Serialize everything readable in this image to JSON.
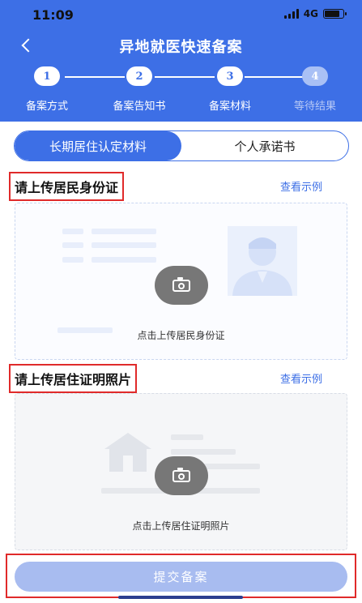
{
  "status": {
    "time": "11:09",
    "network": "4G"
  },
  "header": {
    "title": "异地就医快速备案"
  },
  "steps": [
    {
      "num": "1",
      "label": "备案方式",
      "state": "done"
    },
    {
      "num": "2",
      "label": "备案告知书",
      "state": "done"
    },
    {
      "num": "3",
      "label": "备案材料",
      "state": "current"
    },
    {
      "num": "4",
      "label": "等待结果",
      "state": "pending"
    }
  ],
  "tabs": [
    {
      "label": "长期居住认定材料",
      "active": true
    },
    {
      "label": "个人承诺书",
      "active": false
    }
  ],
  "sections": [
    {
      "title": "请上传居民身份证",
      "link": "查看示例",
      "upload_text": "点击上传居民身份证"
    },
    {
      "title": "请上传居住证明照片",
      "link": "查看示例",
      "upload_text": "点击上传居住证明照片"
    }
  ],
  "submit": {
    "label": "提交备案"
  },
  "colors": {
    "primary": "#3d6fe6",
    "highlight": "#e02a2a",
    "button_disabled": "#a8bcf0"
  },
  "icons": [
    "back-chevron-icon",
    "camera-icon",
    "id-card-avatar-icon",
    "house-icon",
    "signal-icon",
    "battery-icon"
  ]
}
